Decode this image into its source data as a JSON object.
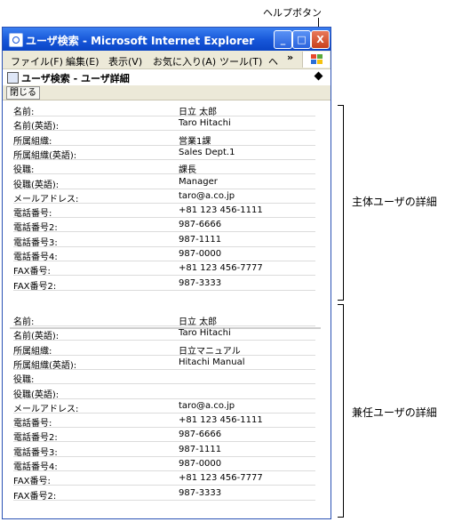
{
  "callout": {
    "help_button_label": "ヘルプボタン"
  },
  "window": {
    "title": "ユーザ検索 - Microsoft Internet Explorer",
    "minimize": "_",
    "maximize": "□",
    "close": "X"
  },
  "menu": {
    "items": [
      "ファイル(F)",
      "編集(E)",
      "表示(V)",
      "お気に入り(A)",
      "ツール(T)",
      "ヘ"
    ],
    "more": "»"
  },
  "page": {
    "header": "ユーザ検索 - ユーザ詳細",
    "close_label": "閉じる"
  },
  "primary_user": {
    "rows": [
      {
        "label": "名前:",
        "value": "日立 太郎"
      },
      {
        "label": "名前(英語):",
        "value": "Taro Hitachi"
      },
      {
        "label": "所属組織:",
        "value": "営業1課"
      },
      {
        "label": "所属組織(英語):",
        "value": "Sales Dept.1"
      },
      {
        "label": "役職:",
        "value": "課長"
      },
      {
        "label": "役職(英語):",
        "value": "Manager"
      },
      {
        "label": "メールアドレス:",
        "value": "taro@a.co.jp"
      },
      {
        "label": "電話番号:",
        "value": "+81 123 456-1111"
      },
      {
        "label": "電話番号2:",
        "value": "987-6666"
      },
      {
        "label": "電話番号3:",
        "value": "987-1111"
      },
      {
        "label": "電話番号4:",
        "value": "987-0000"
      },
      {
        "label": "FAX番号:",
        "value": "+81 123 456-7777"
      },
      {
        "label": "FAX番号2:",
        "value": "987-3333"
      }
    ]
  },
  "secondary_user": {
    "rows": [
      {
        "label": "名前:",
        "value": "日立 太郎"
      },
      {
        "label": "名前(英語):",
        "value": "Taro Hitachi"
      },
      {
        "label": "所属組織:",
        "value": "日立マニュアル"
      },
      {
        "label": "所属組織(英語):",
        "value": "Hitachi Manual"
      },
      {
        "label": "役職:",
        "value": ""
      },
      {
        "label": "役職(英語):",
        "value": ""
      },
      {
        "label": "メールアドレス:",
        "value": "taro@a.co.jp"
      },
      {
        "label": "電話番号:",
        "value": "+81 123 456-1111"
      },
      {
        "label": "電話番号2:",
        "value": "987-6666"
      },
      {
        "label": "電話番号3:",
        "value": "987-1111"
      },
      {
        "label": "電話番号4:",
        "value": "987-0000"
      },
      {
        "label": "FAX番号:",
        "value": "+81 123 456-7777"
      },
      {
        "label": "FAX番号2:",
        "value": "987-3333"
      }
    ]
  },
  "annotations": {
    "primary_label": "主体ユーザの詳細",
    "secondary_label": "兼任ユーザの詳細"
  }
}
